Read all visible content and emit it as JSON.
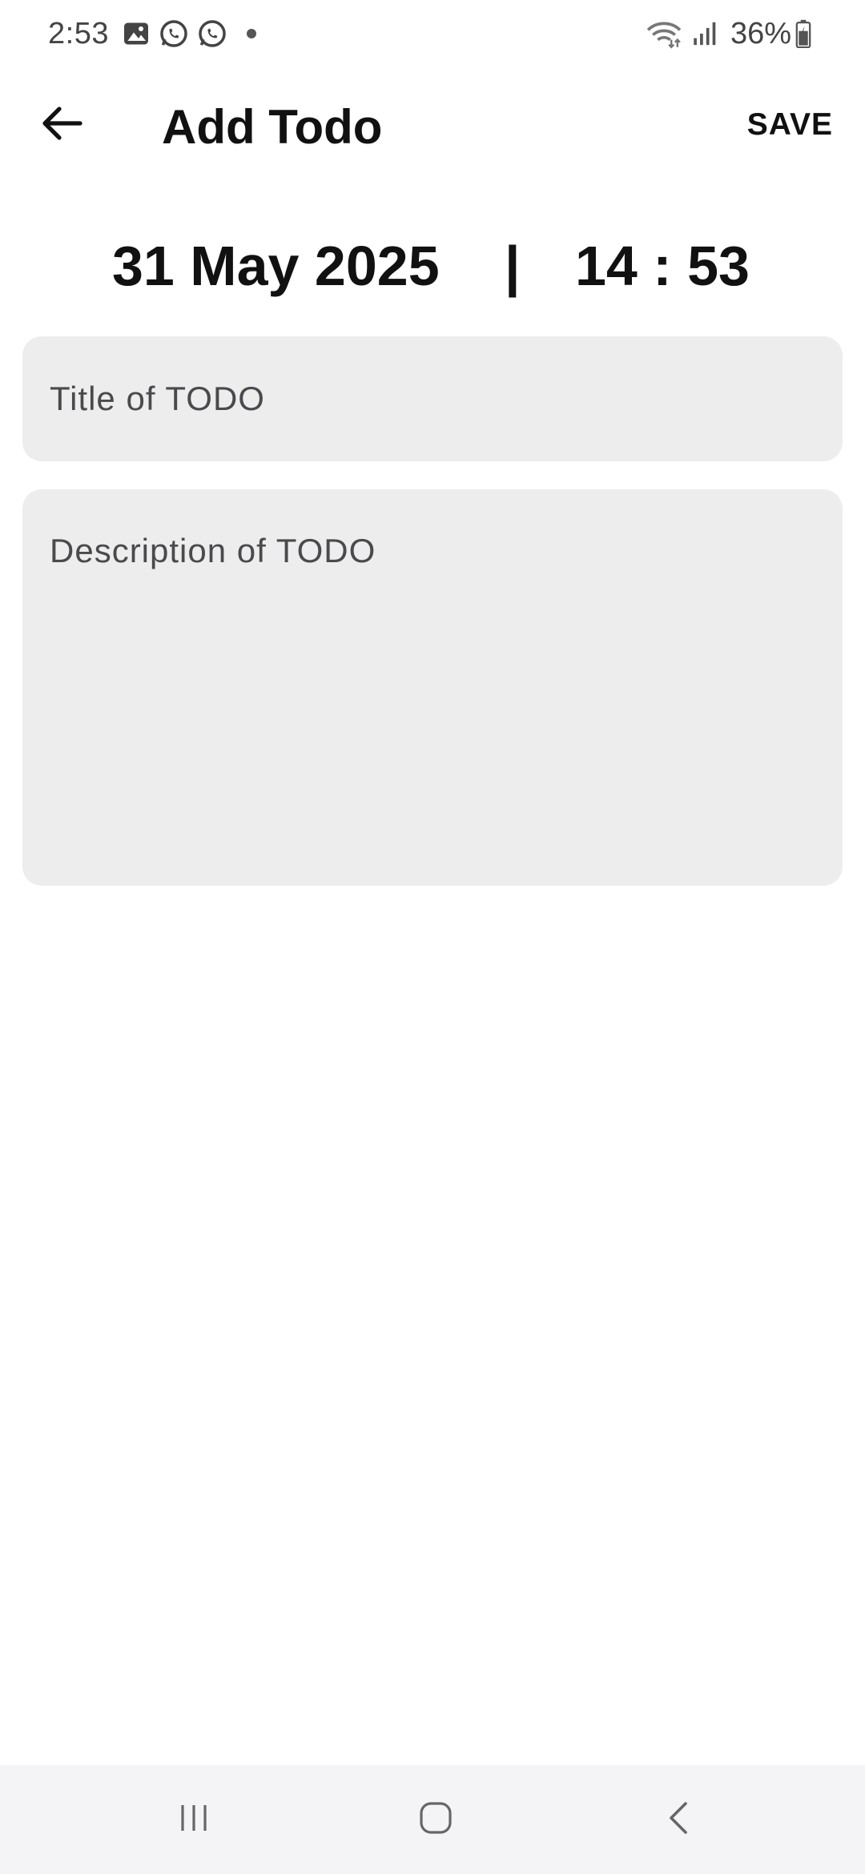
{
  "status_bar": {
    "time": "2:53",
    "battery": "36%",
    "notification_icons": [
      "image-icon",
      "whatsapp-icon",
      "whatsapp-icon",
      "dot-icon"
    ],
    "system_icons": [
      "wifi-icon",
      "signal-icon",
      "battery-icon"
    ]
  },
  "app_bar": {
    "title": "Add Todo",
    "save_label": "SAVE",
    "back_icon": "arrow-left-icon"
  },
  "datetime": {
    "date": "31 May 2025",
    "separator": "|",
    "time": "14 : 53"
  },
  "form": {
    "title_placeholder": "Title of TODO",
    "title_value": "",
    "description_placeholder": "Description of TODO",
    "description_value": ""
  },
  "nav_bar": {
    "icons": [
      "recents-icon",
      "home-icon",
      "back-icon"
    ]
  },
  "colors": {
    "background": "#ffffff",
    "field_background": "#ededed",
    "nav_background": "#f4f4f6",
    "text": "#111111",
    "placeholder": "#4a4a4e"
  }
}
